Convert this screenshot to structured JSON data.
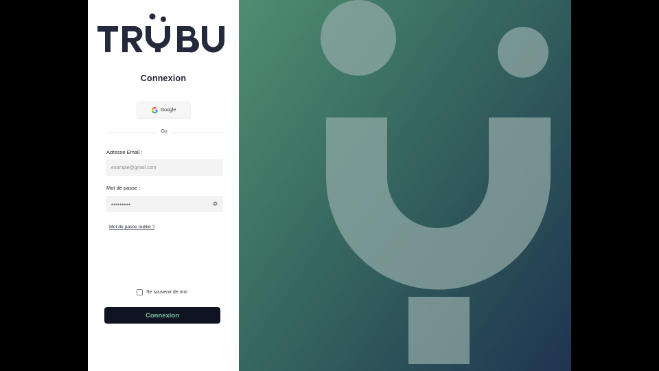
{
  "brand": {
    "logo_text": "TRYBU"
  },
  "login": {
    "title": "Connexion",
    "google_label": "Google",
    "divider_label": "Ou",
    "email_label": "Adresse Email :",
    "email_placeholder": "example@gmail.com",
    "password_label": "Mot de passe :",
    "password_value": "•••••••••",
    "forgot_label": "Mot de passe oublié ?",
    "remember_label": "Se souvenir de moi",
    "submit_label": "Connexion"
  },
  "colors": {
    "brand_dark": "#242a3b",
    "button_bg": "#0f1322",
    "button_text": "#78c39b",
    "hero_gradient_start": "#4f8d71",
    "hero_gradient_end": "#1f3450",
    "hero_shape": "#8fa7a5"
  },
  "icons": {
    "google": "google-g-icon",
    "password_toggle": "eye-icon",
    "hero": "trybu-smile-logo-mark"
  }
}
